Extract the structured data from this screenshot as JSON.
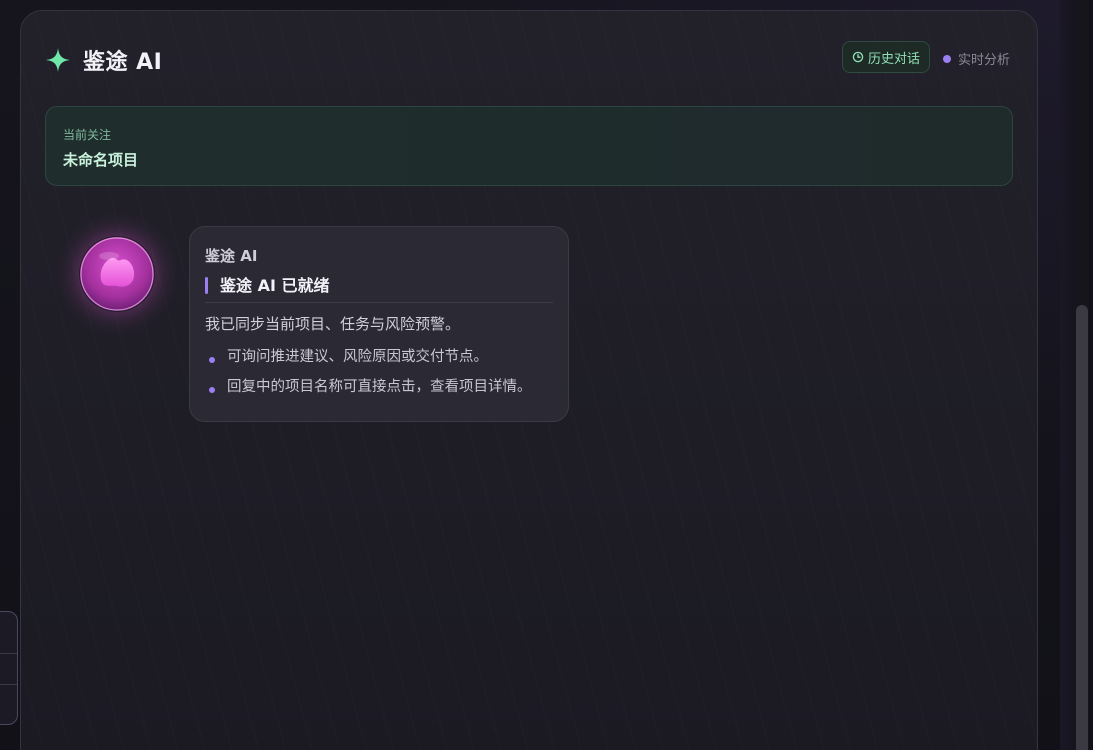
{
  "header": {
    "title": "鉴途 AI",
    "history_label": "历史对话",
    "status_label": "实时分析"
  },
  "focus": {
    "label": "当前关注",
    "value": "未命名项目"
  },
  "message": {
    "sender": "鉴途 AI",
    "heading": "鉴途 AI 已就绪",
    "text": "我已同步当前项目、任务与风险预警。",
    "bullets": [
      "可询问推进建议、风险原因或交付节点。",
      "回复中的项目名称可直接点击，查看项目详情。"
    ]
  },
  "colors": {
    "accent_green": "#6ee7a8",
    "accent_purple": "#9a7ff0",
    "avatar_pink": "#f06ee6"
  },
  "icons": {
    "logo": "sparkle-icon",
    "history": "clock-icon",
    "status": "status-dot-icon"
  }
}
